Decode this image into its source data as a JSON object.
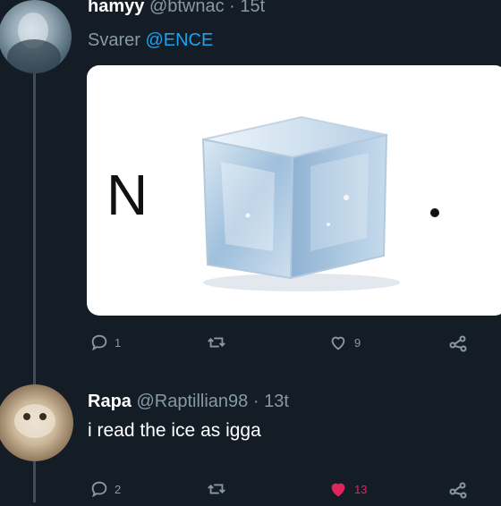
{
  "tweet1": {
    "display_name": "hamyy",
    "handle": "@btwnac",
    "separator": "·",
    "time": "15t",
    "reply_prefix": "Svarer",
    "reply_mention": "@ENCE",
    "image": {
      "letter": "N",
      "icon": "ice-cube"
    },
    "actions": {
      "reply_count": "1",
      "retweet_count": "",
      "like_count": "9"
    }
  },
  "tweet2": {
    "display_name": "Rapa",
    "handle": "@Raptillian98",
    "separator": "·",
    "time": "13t",
    "text": "i read the ice as igga",
    "actions": {
      "reply_count": "2",
      "retweet_count": "",
      "like_count": "13"
    }
  },
  "colors": {
    "background": "#141d26",
    "muted": "#8899a6",
    "mention": "#1da1f2",
    "like_active": "#e0245e"
  }
}
